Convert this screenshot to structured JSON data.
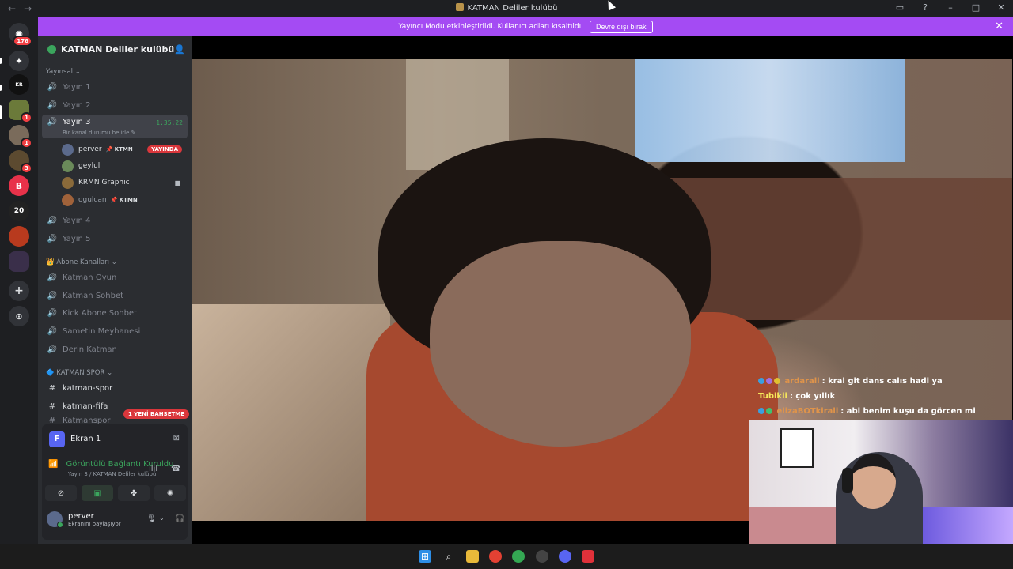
{
  "window": {
    "title": "KATMAN Deliler kulübü",
    "back_icon": "arrow-left-icon",
    "forward_icon": "arrow-right-icon"
  },
  "banner": {
    "text": "Yayıncı Modu etkinleştirildi. Kullanıcı adları kısaltıldı.",
    "button": "Devre dışı bırak",
    "bg": "#a44bf3"
  },
  "guilds": {
    "home_badge": "176",
    "items": [
      {
        "badge": "1"
      },
      {
        "badge": "1"
      },
      {
        "badge": "3"
      }
    ]
  },
  "server": {
    "name": "KATMAN Deliler kulübü"
  },
  "categories": {
    "yayinsal": "Yayınsal",
    "abone": "Abone Kanalları",
    "spor": "KATMAN SPOR"
  },
  "channels": {
    "yayin1": "Yayın 1",
    "yayin2": "Yayın 2",
    "yayin3": "Yayın 3",
    "yayin3_timer": "1:35:22",
    "yayin3_status": "Bir kanal durumu belirle",
    "yayin4": "Yayın 4",
    "yayin5": "Yayın 5",
    "katman_oyun": "Katman Oyun",
    "katman_sohbet": "Katman Sohbet",
    "kick_abone": "Kick Abone Sohbet",
    "samet": "Sametin Meyhanesi",
    "derin": "Derin Katman",
    "spor": "katman-spor",
    "fifa": "katman-fifa",
    "katmanspor": "Katmanspor"
  },
  "members": [
    {
      "name": "perver",
      "tag": "KTMN",
      "live": "YAYINDA"
    },
    {
      "name": "geylul"
    },
    {
      "name": "KRMN Graphic"
    },
    {
      "name": "ogulcan",
      "tag": "KTMN"
    }
  ],
  "mention_badge": "1 YENİ BAHSETME",
  "panel": {
    "screen_initial": "F",
    "screen_name": "Ekran 1",
    "connected": "Görüntülü Bağlantı Kuruldu",
    "location": "Yayın 3 / KATMAN Deliler kulübü",
    "user_name": "perver",
    "user_status": "Ekranını paylaşıyor"
  },
  "chat": [
    {
      "user": "ardarall",
      "color": "#e0944a",
      "msg": ": kral git dans calıs hadi ya"
    },
    {
      "user": "Tubikii",
      "color": "#f5e65a",
      "msg": ": çok yıllık"
    },
    {
      "user": "elizaBOTkirali",
      "color": "#e0944a",
      "msg": ": abi benim kuşu da görcen mi"
    }
  ],
  "accent": "#3ba55d",
  "danger": "#da373c"
}
